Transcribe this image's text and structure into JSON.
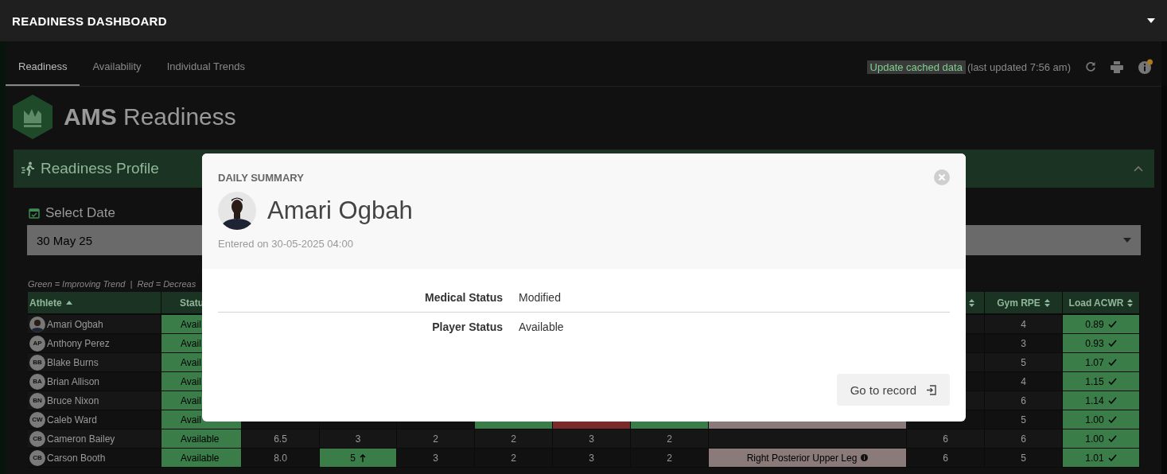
{
  "top_bar": {
    "title": "READINESS DASHBOARD"
  },
  "tabs": [
    {
      "label": "Readiness",
      "selected": true
    },
    {
      "label": "Availability",
      "selected": false
    },
    {
      "label": "Individual Trends",
      "selected": false
    }
  ],
  "toolbar": {
    "update_button": "Update cached data",
    "last_updated": "(last updated 7:56 am)",
    "notification": true
  },
  "logo": {
    "bold": "AMS",
    "light": "Readiness"
  },
  "profile_panel": {
    "title": "Readiness Profile",
    "expanded": true
  },
  "date_field": {
    "label": "Select Date",
    "value": "30 May 25"
  },
  "legend": "Green = Improving Trend  |  Red = Decreas",
  "table": {
    "columns": [
      {
        "label": "Athlete",
        "sorted": true
      },
      {
        "label": "Statu"
      },
      null,
      null,
      null,
      null,
      null,
      null,
      null,
      {
        "sorted": false
      },
      {
        "label": "Gym RPE",
        "sorted": false
      },
      {
        "label": "Load ACWR",
        "sorted": false
      }
    ],
    "rows": [
      {
        "cells": [
          {
            "text": "Amari Ogbah",
            "kind": "athlete"
          },
          {
            "text": "Avail",
            "color": "#3a7d48",
            "kind": "plain"
          },
          null,
          null,
          null,
          null,
          null,
          null,
          null,
          null,
          {
            "text": "4",
            "kind": "plain"
          },
          {
            "text": "0.89",
            "color": "#3a7d48",
            "kind": "check"
          }
        ]
      },
      {
        "cells": [
          {
            "text": "Anthony Perez",
            "kind": "athlete",
            "avatar": {
              "kind": "initials",
              "text": "AP"
            }
          },
          {
            "text": "Avail",
            "color": "#3a7d48",
            "kind": "plain"
          },
          null,
          null,
          null,
          null,
          null,
          null,
          null,
          null,
          {
            "text": "3",
            "kind": "plain"
          },
          {
            "text": "0.93",
            "color": "#3a7d48",
            "kind": "check"
          }
        ]
      },
      {
        "cells": [
          {
            "text": "Blake Burns",
            "kind": "athlete",
            "avatar": {
              "kind": "initials",
              "text": "BB"
            }
          },
          {
            "text": "Avail",
            "color": "#3a7d48",
            "kind": "plain"
          },
          null,
          null,
          null,
          null,
          null,
          null,
          null,
          null,
          {
            "text": "5",
            "kind": "plain"
          },
          {
            "text": "1.07",
            "color": "#3a7d48",
            "kind": "check"
          }
        ]
      },
      {
        "cells": [
          {
            "text": "Brian Allison",
            "kind": "athlete",
            "avatar": {
              "kind": "initials",
              "text": "BA"
            }
          },
          {
            "text": "Avail",
            "color": "#3a7d48",
            "kind": "plain"
          },
          null,
          null,
          null,
          null,
          null,
          null,
          null,
          null,
          {
            "text": "4",
            "kind": "plain"
          },
          {
            "text": "1.15",
            "color": "#3a7d48",
            "kind": "check"
          }
        ]
      },
      {
        "cells": [
          {
            "text": "Bruce Nixon",
            "kind": "athlete",
            "avatar": {
              "kind": "initials",
              "text": "BN"
            }
          },
          {
            "text": "Avail",
            "color": "#3a7d48",
            "kind": "plain"
          },
          null,
          null,
          null,
          null,
          null,
          null,
          null,
          null,
          {
            "text": "6",
            "kind": "plain"
          },
          {
            "text": "1.14",
            "color": "#3a7d48",
            "kind": "check"
          }
        ]
      },
      {
        "cells": [
          {
            "text": "Caleb Ward",
            "kind": "athlete",
            "avatar": {
              "kind": "initials",
              "text": "CW"
            }
          },
          {
            "text": "Avail",
            "color": "#3a7d48",
            "kind": "plain"
          },
          {
            "kind": "plain"
          },
          {
            "kind": "plain"
          },
          {
            "kind": "plain"
          },
          {
            "color": "#3a7d48",
            "kind": "plain"
          },
          {
            "color": "#7a2a2a",
            "kind": "plain"
          },
          {
            "color": "#3a7d48",
            "kind": "plain"
          },
          {
            "color": "#8a7a7a",
            "kind": "plain"
          },
          null,
          {
            "text": "5",
            "kind": "plain"
          },
          {
            "text": "1.00",
            "color": "#3a7d48",
            "kind": "check"
          }
        ]
      },
      {
        "cells": [
          {
            "text": "Cameron Bailey",
            "kind": "athlete",
            "avatar": {
              "kind": "initials",
              "text": "CB"
            }
          },
          {
            "text": "Available",
            "color": "#3a7d48",
            "kind": "plain"
          },
          {
            "text": "6.5",
            "kind": "plain"
          },
          {
            "text": "3",
            "kind": "plain"
          },
          {
            "text": "2",
            "kind": "plain"
          },
          {
            "text": "2",
            "kind": "plain"
          },
          {
            "text": "3",
            "kind": "plain"
          },
          {
            "text": "2",
            "kind": "plain"
          },
          {
            "kind": "plain"
          },
          {
            "text": "6",
            "kind": "plain"
          },
          {
            "text": "6",
            "kind": "plain"
          },
          {
            "text": "1.00",
            "color": "#3a7d48",
            "kind": "check"
          }
        ]
      },
      {
        "cells": [
          {
            "text": "Carson Booth",
            "kind": "athlete",
            "avatar": {
              "kind": "initials",
              "text": "CB"
            }
          },
          {
            "text": "Available",
            "color": "#3a7d48",
            "kind": "plain"
          },
          {
            "text": "8.0",
            "kind": "plain"
          },
          {
            "text": "5",
            "color": "#3a7d48",
            "kind": "trend"
          },
          {
            "text": "3",
            "kind": "plain"
          },
          {
            "text": "2",
            "kind": "plain"
          },
          {
            "text": "3",
            "kind": "plain"
          },
          {
            "text": "2",
            "kind": "plain"
          },
          {
            "text": "Right Posterior Upper Leg",
            "color": "#8a7a7a",
            "kind": "injury"
          },
          {
            "text": "6",
            "kind": "plain"
          },
          {
            "text": "5",
            "kind": "plain"
          },
          {
            "text": "1.01",
            "color": "#3a7d48",
            "kind": "check"
          }
        ]
      }
    ]
  },
  "modal": {
    "heading": "DAILY SUMMARY",
    "name": "Amari Ogbah",
    "entered": "Entered on 30-05-2025 04:00",
    "fields": [
      {
        "label": "Medical Status",
        "value": "Modified"
      },
      {
        "label": "Player Status",
        "value": "Available"
      }
    ],
    "button": "Go to record"
  }
}
